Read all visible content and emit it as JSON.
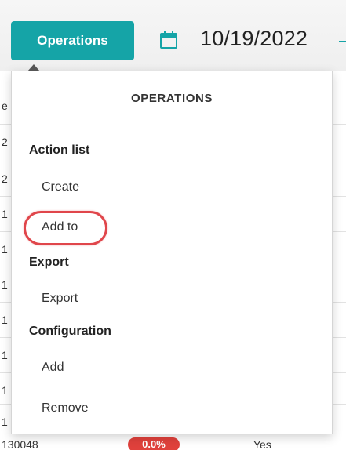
{
  "toolbar": {
    "operations_button_label": "Operations",
    "date": "10/19/2022",
    "calendar_icon": "calendar-icon",
    "accent_color": "#15a4a7"
  },
  "background_table": {
    "header_partial": "e",
    "row_fragments": [
      "2",
      "2",
      "1",
      "1",
      "1",
      "1",
      "1",
      "1",
      "1"
    ],
    "last_row": {
      "id": "130048",
      "badge": "0.0%",
      "flag": "Yes"
    }
  },
  "dropdown": {
    "title": "OPERATIONS",
    "sections": [
      {
        "title": "Action list",
        "items": [
          "Create",
          "Add to"
        ]
      },
      {
        "title": "Export",
        "items": [
          "Export"
        ]
      },
      {
        "title": "Configuration",
        "items": [
          "Add",
          "Remove"
        ]
      }
    ],
    "highlighted_item": "Add to",
    "highlight_color": "#e0464b"
  }
}
